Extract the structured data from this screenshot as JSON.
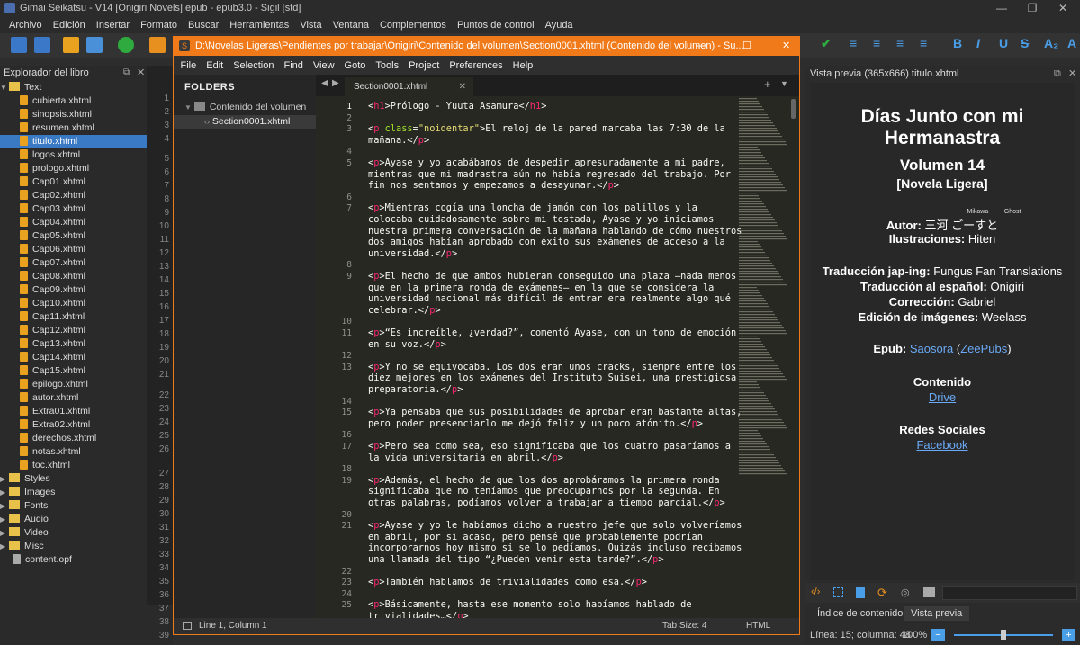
{
  "window": {
    "title": "Gimai Seikatsu - V14 [Onigiri Novels].epub - epub3.0 - Sigil [std]"
  },
  "menu": [
    "Archivo",
    "Edición",
    "Insertar",
    "Formato",
    "Buscar",
    "Herramientas",
    "Vista",
    "Ventana",
    "Complementos",
    "Puntos de control",
    "Ayuda"
  ],
  "book_browser": {
    "title": "Explorador del libro",
    "text_folder": "Text",
    "files": [
      "cubierta.xhtml",
      "sinopsis.xhtml",
      "resumen.xhtml",
      "titulo.xhtml",
      "logos.xhtml",
      "prologo.xhtml",
      "Cap01.xhtml",
      "Cap02.xhtml",
      "Cap03.xhtml",
      "Cap04.xhtml",
      "Cap05.xhtml",
      "Cap06.xhtml",
      "Cap07.xhtml",
      "Cap08.xhtml",
      "Cap09.xhtml",
      "Cap10.xhtml",
      "Cap11.xhtml",
      "Cap12.xhtml",
      "Cap13.xhtml",
      "Cap14.xhtml",
      "Cap15.xhtml",
      "epilogo.xhtml",
      "autor.xhtml",
      "Extra01.xhtml",
      "Extra02.xhtml",
      "derechos.xhtml",
      "notas.xhtml",
      "toc.xhtml"
    ],
    "selected": "titulo.xhtml",
    "folders": [
      "Styles",
      "Images",
      "Fonts",
      "Audio",
      "Video",
      "Misc"
    ],
    "opf": "content.opf"
  },
  "left_gutter": [
    "1",
    "2",
    "3",
    "4",
    "5",
    "6",
    "7",
    "8",
    "9",
    "10",
    "11",
    "12",
    "13",
    "14",
    "15",
    "16",
    "17",
    "18",
    "19",
    "20",
    "21",
    "22",
    "23",
    "24",
    "25",
    "26",
    "27",
    "28",
    "29",
    "30",
    "31",
    "32",
    "33",
    "34",
    "35",
    "36",
    "37",
    "38",
    "39"
  ],
  "sublime": {
    "title": "D:\\Novelas Ligeras\\Pendientes por trabajar\\Onigiri\\Contenido del volumen\\Section0001.xhtml (Contenido del volumen) - Su...",
    "menu": [
      "File",
      "Edit",
      "Selection",
      "Find",
      "View",
      "Goto",
      "Tools",
      "Project",
      "Preferences",
      "Help"
    ],
    "sidebar": {
      "title": "FOLDERS",
      "folder": "Contenido del volumen",
      "file": "Section0001.xhtml"
    },
    "tab": "Section0001.xhtml",
    "status": {
      "position": "Line 1, Column 1",
      "tabsize": "Tab Size: 4",
      "syntax": "HTML"
    }
  },
  "code": [
    {
      "n": "1",
      "t": "<h1>Prólogo - Yuuta Asamura</h1>"
    },
    {
      "n": "2",
      "t": ""
    },
    {
      "n": "3",
      "t": "<p class=\"noidentar\">El reloj de la pared marcaba las 7:30 de la\nmañana.</p>"
    },
    {
      "n": "4",
      "t": ""
    },
    {
      "n": "5",
      "t": "<p>Ayase y yo acabábamos de despedir apresuradamente a mi padre,\nmientras que mi madrastra aún no había regresado del trabajo. Por\nfin nos sentamos y empezamos a desayunar.</p>"
    },
    {
      "n": "6",
      "t": ""
    },
    {
      "n": "7",
      "t": "<p>Mientras cogía una loncha de jamón con los palillos y la\ncolocaba cuidadosamente sobre mi tostada, Ayase y yo iniciamos\nnuestra primera conversación de la mañana hablando de cómo nuestros\ndos amigos habían aprobado con éxito sus exámenes de acceso a la\nuniversidad.</p>"
    },
    {
      "n": "8",
      "t": ""
    },
    {
      "n": "9",
      "t": "<p>El hecho de que ambos hubieran conseguido una plaza —nada menos\nque en la primera ronda de exámenes— en la que se considera la\nuniversidad nacional más difícil de entrar era realmente algo qué\ncelebrar.</p>"
    },
    {
      "n": "10",
      "t": ""
    },
    {
      "n": "11",
      "t": "<p>“Es increíble, ¿verdad?”, comentó Ayase, con un tono de emoción\nen su voz.</p>"
    },
    {
      "n": "12",
      "t": ""
    },
    {
      "n": "13",
      "t": "<p>Y no se equivocaba. Los dos eran unos cracks, siempre entre los\ndiez mejores en los exámenes del Instituto Suisei, una prestigiosa\npreparatoria.</p>"
    },
    {
      "n": "14",
      "t": ""
    },
    {
      "n": "15",
      "t": "<p>Ya pensaba que sus posibilidades de aprobar eran bastante altas,\npero poder presenciarlo me dejó feliz y un poco atónito.</p>"
    },
    {
      "n": "16",
      "t": ""
    },
    {
      "n": "17",
      "t": "<p>Pero sea como sea, eso significaba que los cuatro pasaríamos a\nla vida universitaria en abril.</p>"
    },
    {
      "n": "18",
      "t": ""
    },
    {
      "n": "19",
      "t": "<p>Además, el hecho de que los dos aprobáramos la primera ronda\nsignificaba que no teníamos que preocuparnos por la segunda. En\notras palabras, podíamos volver a trabajar a tiempo parcial.</p>"
    },
    {
      "n": "20",
      "t": ""
    },
    {
      "n": "21",
      "t": "<p>Ayase y yo le habíamos dicho a nuestro jefe que solo volveríamos\nen abril, por si acaso, pero pensé que probablemente podrían\nincorporarnos hoy mismo si se lo pedíamos. Quizás incluso recibamos\nuna llamada del tipo “¿Pueden venir esta tarde?”.</p>"
    },
    {
      "n": "22",
      "t": ""
    },
    {
      "n": "23",
      "t": "<p>También hablamos de trivialidades como esa.</p>"
    },
    {
      "n": "24",
      "t": ""
    },
    {
      "n": "25",
      "t": "<p>Básicamente, hasta ese momento solo habíamos hablado de\ntrivialidades…</p>"
    }
  ],
  "preview": {
    "title": "Vista previa (365x666) titulo.xhtml",
    "book_title": "Días Junto con mi Hermanastra",
    "volume": "Volumen 14",
    "subtitle": "[Novela Ligera]",
    "author_label": "Autor:",
    "author": "三河 ごーすと",
    "ruby_1": "Mikawa",
    "ruby_2": "Ghost",
    "illus_label": "Ilustraciones:",
    "illus": "Hiten",
    "trad_label": "Traducción jap-ing:",
    "trad": "Fungus Fan Translations",
    "trad_es_label": "Traducción al español:",
    "trad_es": "Onigiri",
    "corr_label": "Corrección:",
    "corr": "Gabriel",
    "img_label": "Edición de imágenes:",
    "img": "Weelass",
    "epub_label": "Epub:",
    "epub_link": "Saosora",
    "epub_link2": "ZeePubs",
    "contenido": "Contenido",
    "drive": "Drive",
    "redes": "Redes Sociales",
    "facebook": "Facebook"
  },
  "bottom_tabs": {
    "toc": "Índice de contenido",
    "preview": "Vista previa"
  },
  "status_bar": {
    "text": "Línea: 15; columna: 48",
    "zoom": "100%"
  }
}
